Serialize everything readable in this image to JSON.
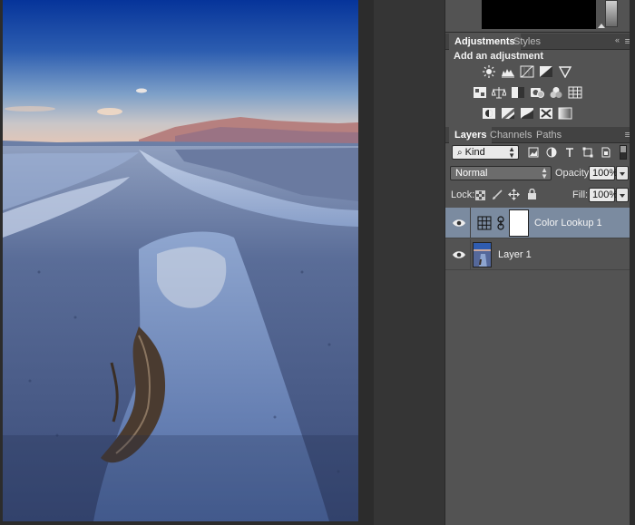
{
  "adjustments_panel": {
    "tabs": [
      {
        "label": "Adjustments",
        "active": true
      },
      {
        "label": "Styles",
        "active": false
      }
    ],
    "title": "Add an adjustment",
    "icons": [
      [
        "brightness-contrast-icon",
        "levels-icon",
        "curves-icon",
        "exposure-icon",
        "vibrance-icon"
      ],
      [
        "hue-saturation-icon",
        "color-balance-icon",
        "black-white-icon",
        "photo-filter-icon",
        "channel-mixer-icon",
        "color-lookup-icon"
      ],
      [
        "invert-icon",
        "posterize-icon",
        "threshold-icon",
        "selective-color-icon",
        "gradient-map-icon"
      ]
    ]
  },
  "layers_panel": {
    "tabs": [
      {
        "label": "Layers",
        "active": true
      },
      {
        "label": "Channels",
        "active": false
      },
      {
        "label": "Paths",
        "active": false
      }
    ],
    "filter_kind": "Kind",
    "blend_mode": "Normal",
    "opacity_label": "Opacity:",
    "opacity_value": "100%",
    "lock_label": "Lock:",
    "fill_label": "Fill:",
    "fill_value": "100%",
    "layers": [
      {
        "name": "Color Lookup 1",
        "type": "adjustment",
        "selected": true,
        "visible": true
      },
      {
        "name": "Layer 1",
        "type": "image",
        "selected": false,
        "visible": true
      }
    ]
  },
  "colors": {
    "panel_bg": "#535353",
    "tab_strip_bg": "#424242",
    "selected_layer": "#7b8ba0",
    "canvas_bg": "#2c2c2c"
  }
}
